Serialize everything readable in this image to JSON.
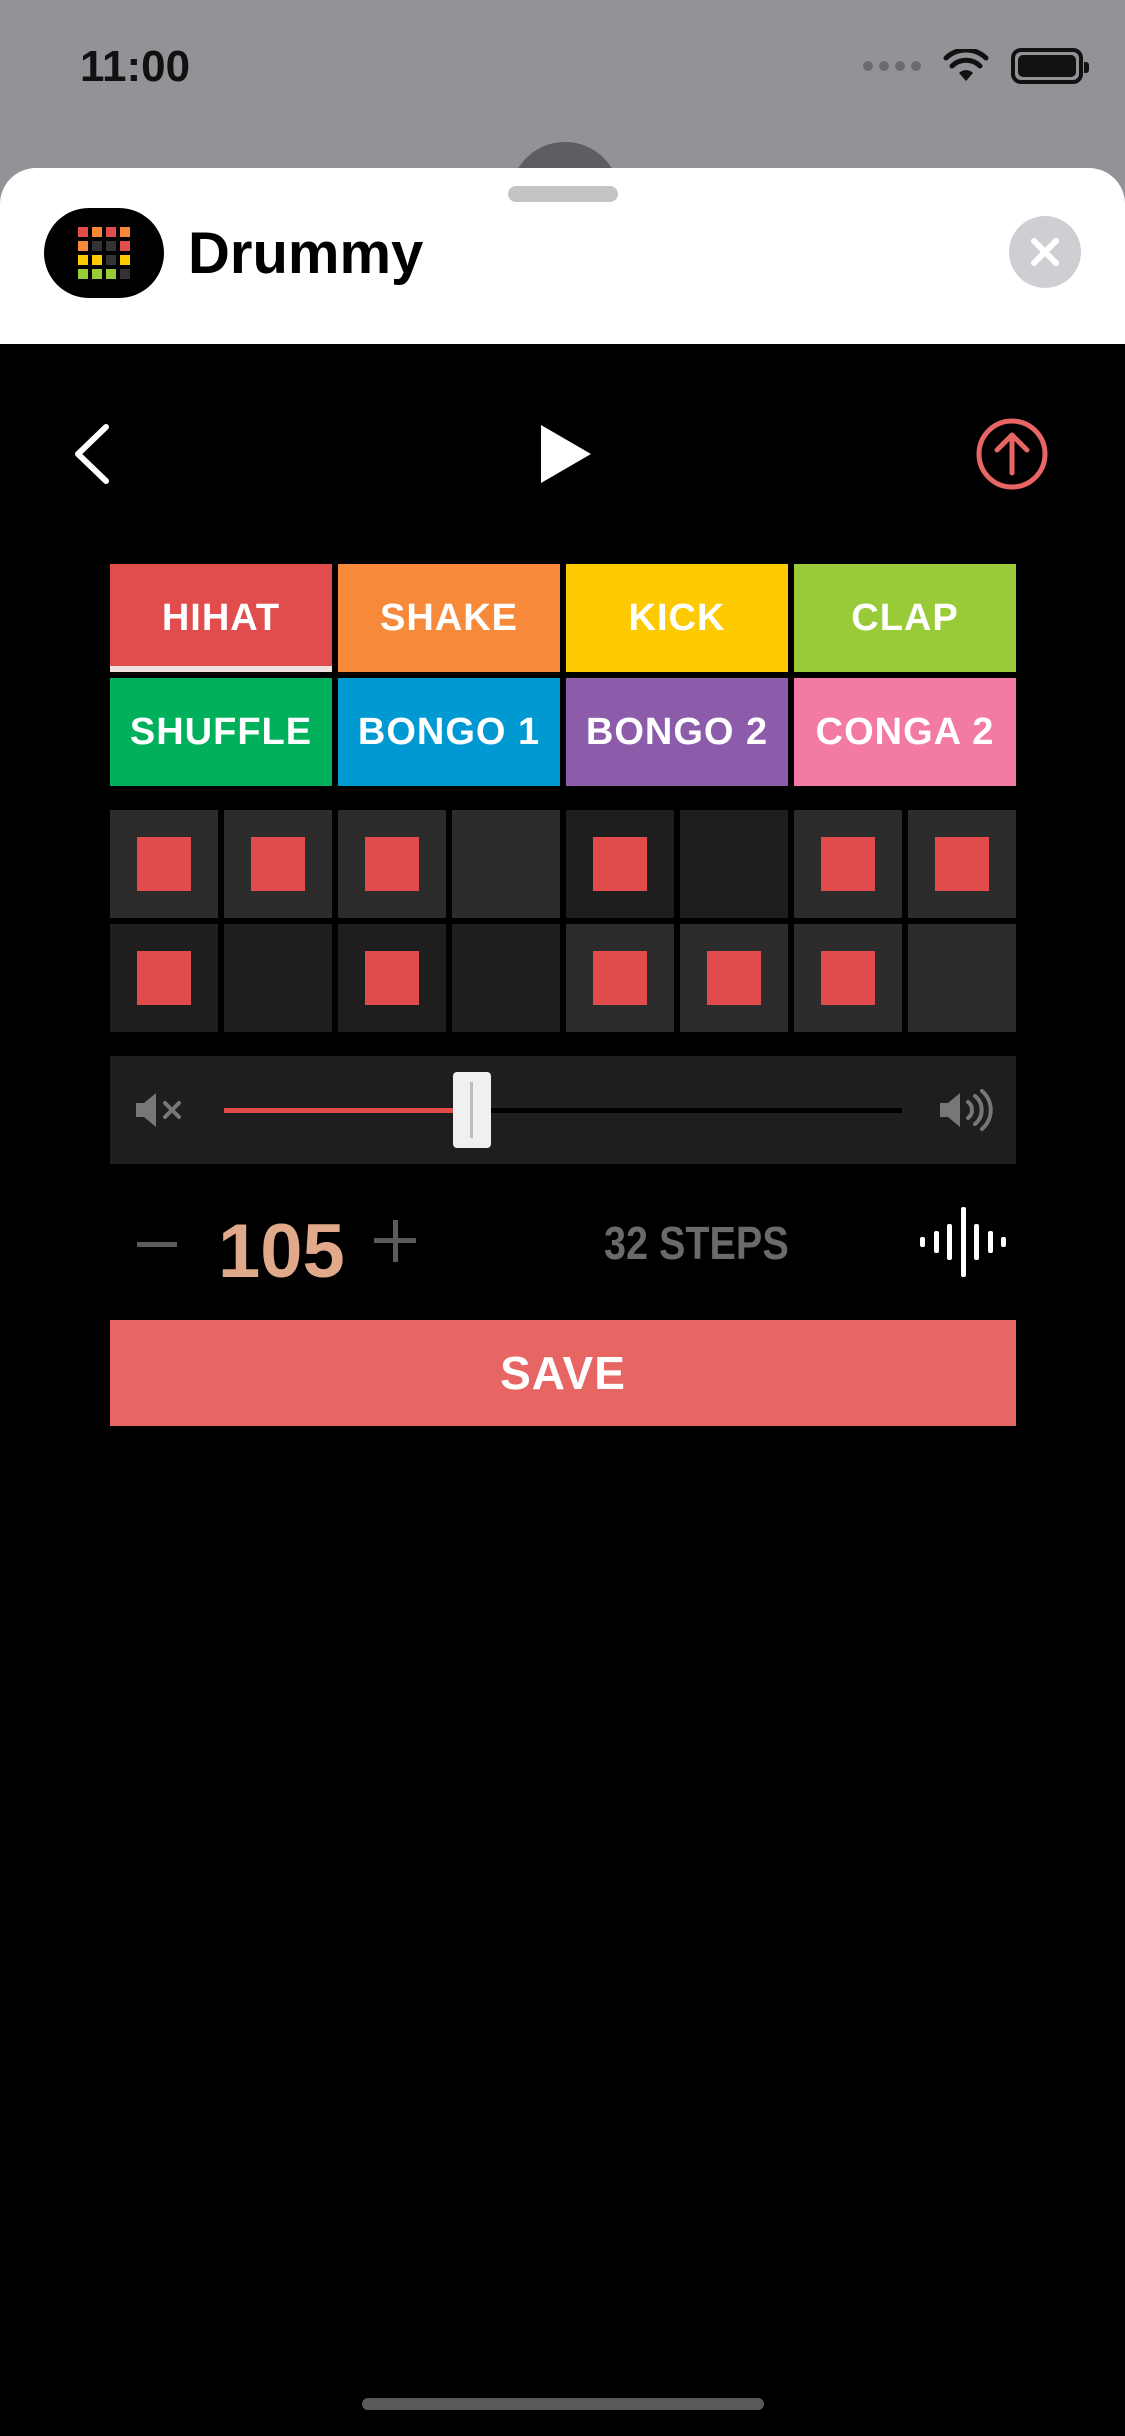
{
  "status_bar": {
    "time": "11:00"
  },
  "app": {
    "name": "Drummy"
  },
  "instruments": [
    {
      "label": "HIHAT",
      "color": "#e14d4d",
      "active": true
    },
    {
      "label": "SHAKE",
      "color": "#f7893b",
      "active": false
    },
    {
      "label": "KICK",
      "color": "#fdc900",
      "active": false
    },
    {
      "label": "CLAP",
      "color": "#99cb39",
      "active": false
    },
    {
      "label": "SHUFFLE",
      "color": "#00b05b",
      "active": false
    },
    {
      "label": "BONGO 1",
      "color": "#0099d2",
      "active": false
    },
    {
      "label": "BONGO 2",
      "color": "#8c5ba9",
      "active": false
    },
    {
      "label": "CONGA 2",
      "color": "#f27aa4",
      "active": false
    }
  ],
  "steps": [
    {
      "on": true,
      "shade": "#2c2c2c"
    },
    {
      "on": true,
      "shade": "#2c2c2c"
    },
    {
      "on": true,
      "shade": "#2c2c2c"
    },
    {
      "on": false,
      "shade": "#2c2c2c"
    },
    {
      "on": true,
      "shade": "#1e1e1e"
    },
    {
      "on": false,
      "shade": "#1e1e1e"
    },
    {
      "on": true,
      "shade": "#2c2c2c"
    },
    {
      "on": true,
      "shade": "#2c2c2c"
    },
    {
      "on": true,
      "shade": "#1e1e1e"
    },
    {
      "on": false,
      "shade": "#1e1e1e"
    },
    {
      "on": true,
      "shade": "#1e1e1e"
    },
    {
      "on": false,
      "shade": "#1e1e1e"
    },
    {
      "on": true,
      "shade": "#2c2c2c"
    },
    {
      "on": true,
      "shade": "#2c2c2c"
    },
    {
      "on": true,
      "shade": "#2c2c2c"
    },
    {
      "on": false,
      "shade": "#2c2c2c"
    }
  ],
  "volume": {
    "level": 0.35
  },
  "tempo": {
    "value": "105"
  },
  "steps_label": "32 STEPS",
  "save_label": "SAVE",
  "colors": {
    "accent": "#e24b4b",
    "save": "#e76663",
    "tempo": "#e0a98a"
  },
  "icons": {
    "back": "chevron-left-icon",
    "play": "play-icon",
    "share": "arrow-up-circle-icon",
    "close": "close-icon",
    "mute": "speaker-mute-icon",
    "loud": "speaker-loud-icon",
    "wave": "waveform-icon"
  }
}
